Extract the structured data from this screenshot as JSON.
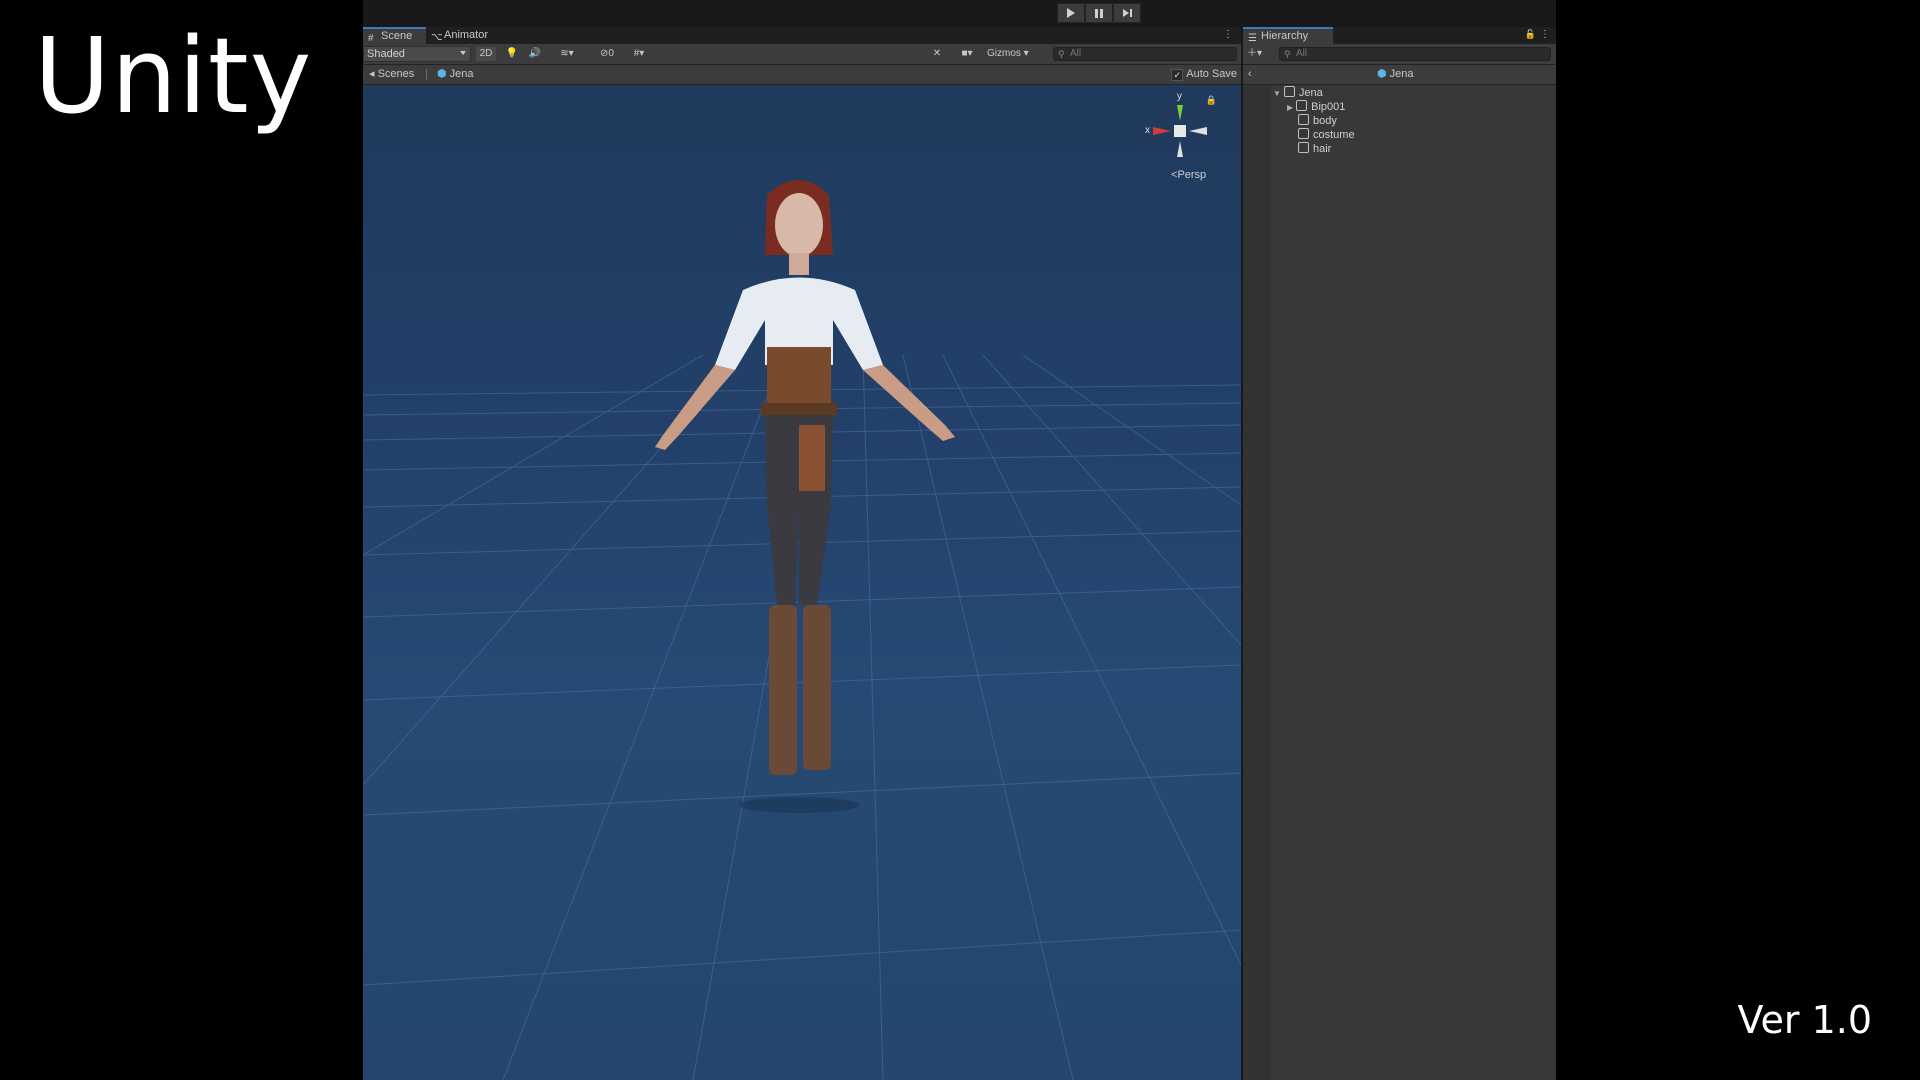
{
  "overlay": {
    "brand": "Unity",
    "version": "Ver 1.0"
  },
  "playbar": {
    "play_icon": "play-icon",
    "pause_icon": "pause-icon",
    "step_icon": "step-icon"
  },
  "scene_window": {
    "tabs": [
      {
        "label": "Scene",
        "icon": "scene-icon",
        "active": true
      },
      {
        "label": "Animator",
        "icon": "animator-icon",
        "active": false
      }
    ],
    "toolbar": {
      "shading_mode": "Shaded",
      "two_d_label": "2D",
      "hidden_count": "0",
      "gizmos_label": "Gizmos",
      "search_placeholder": "All"
    },
    "breadcrumb": {
      "scenes_label": "Scenes",
      "prefab_label": "Jena",
      "auto_save_label": "Auto Save",
      "auto_save_checked": true
    },
    "viewport": {
      "axis_y": "y",
      "axis_x": "x",
      "projection_label": "Persp"
    }
  },
  "hierarchy": {
    "title": "Hierarchy",
    "search_placeholder": "All",
    "header_prefab": "Jena",
    "items": [
      {
        "label": "Jena",
        "depth": 0,
        "expanded": true
      },
      {
        "label": "Bip001",
        "depth": 1,
        "expanded": false
      },
      {
        "label": "body",
        "depth": 1
      },
      {
        "label": "costume",
        "depth": 1
      },
      {
        "label": "hair",
        "depth": 1
      }
    ]
  },
  "colors": {
    "accent": "#3a79bb",
    "viewport_bg": "#22406a",
    "panel_bg": "#383838",
    "toolbar_bg": "#3c3c3c",
    "axis_x": "#d23c3c",
    "axis_y": "#7ccc3a"
  }
}
